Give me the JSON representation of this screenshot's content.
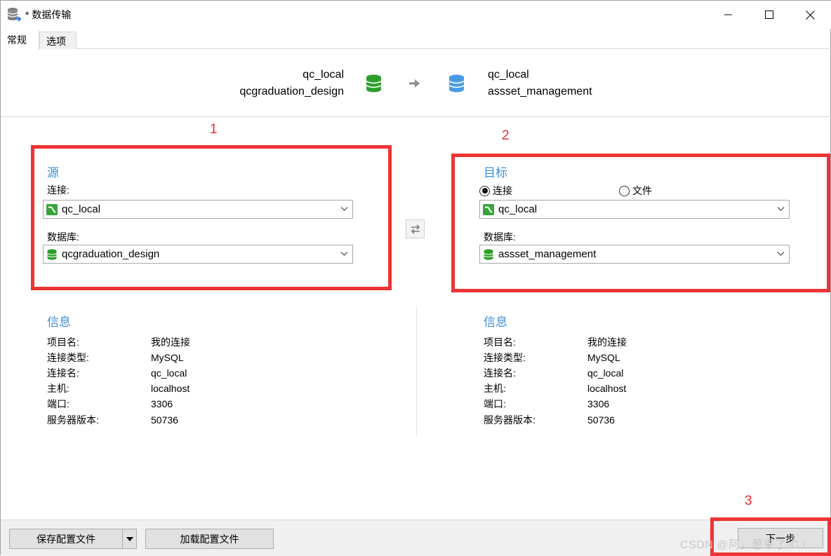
{
  "window": {
    "title": "* 数据传输",
    "icon": "database-transfer-icon",
    "controls": [
      "minimize-icon",
      "maximize-icon",
      "close-icon"
    ]
  },
  "tabs": [
    {
      "label": "常规",
      "active": true
    },
    {
      "label": "选项",
      "active": false
    }
  ],
  "summary": {
    "source_connection": "qc_local",
    "source_database": "qcgraduation_design",
    "target_connection": "qc_local",
    "target_database": "assset_management"
  },
  "annotations": [
    "1",
    "2",
    "3"
  ],
  "source": {
    "title": "源",
    "connection_label": "连接:",
    "connection_value": "qc_local",
    "database_label": "数据库:",
    "database_value": "qcgraduation_design"
  },
  "target": {
    "title": "目标",
    "radio_connection": "连接",
    "radio_file": "文件",
    "selected": "连接",
    "connection_value": "qc_local",
    "database_label": "数据库:",
    "database_value": "assset_management"
  },
  "source_info": {
    "title": "信息",
    "rows": [
      {
        "key": "项目名:",
        "value": "我的连接"
      },
      {
        "key": "连接类型:",
        "value": "MySQL"
      },
      {
        "key": "连接名:",
        "value": "qc_local"
      },
      {
        "key": "主机:",
        "value": "localhost"
      },
      {
        "key": "端口:",
        "value": "3306"
      },
      {
        "key": "服务器版本:",
        "value": "50736"
      }
    ]
  },
  "target_info": {
    "title": "信息",
    "rows": [
      {
        "key": "项目名:",
        "value": "我的连接"
      },
      {
        "key": "连接类型:",
        "value": "MySQL"
      },
      {
        "key": "连接名:",
        "value": "qc_local"
      },
      {
        "key": "主机:",
        "value": "localhost"
      },
      {
        "key": "端口:",
        "value": "3306"
      },
      {
        "key": "服务器版本:",
        "value": "50736"
      }
    ]
  },
  "buttons": {
    "save_profile": "保存配置文件",
    "load_profile": "加载配置文件",
    "next": "下一步"
  },
  "watermark": "CSDN @阿，葱来了-C i",
  "colors": {
    "accent": "#3c8fd4",
    "annotation": "#ee3434",
    "db_green": "#2e9e2a",
    "db_blue": "#4a9be6"
  }
}
